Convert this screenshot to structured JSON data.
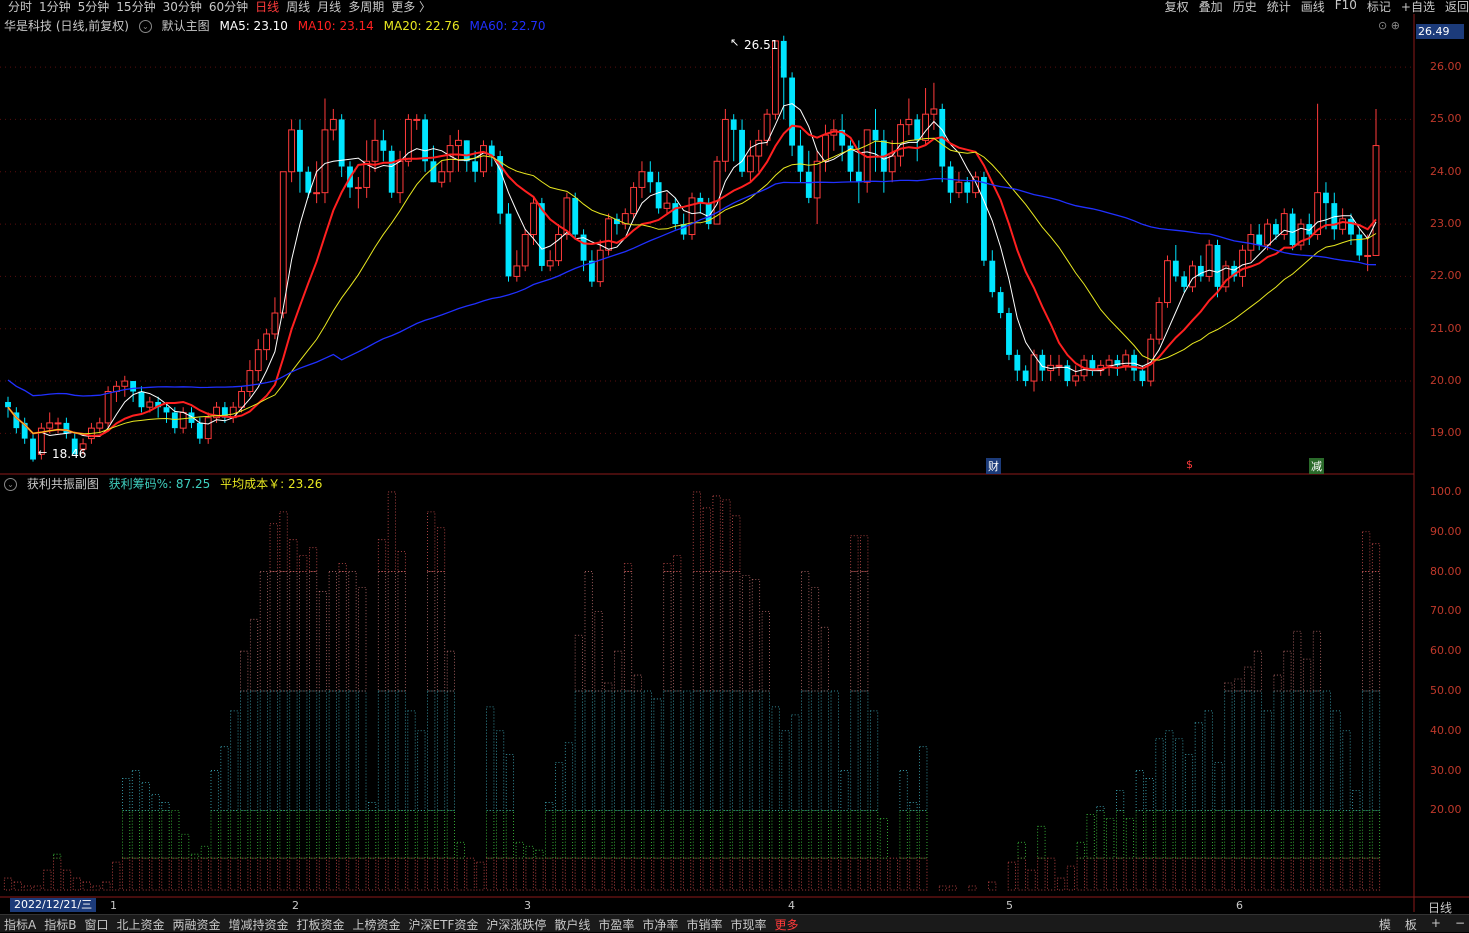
{
  "periods": [
    "分时",
    "1分钟",
    "5分钟",
    "15分钟",
    "30分钟",
    "60分钟",
    "日线",
    "周线",
    "月线",
    "多周期",
    "更多 〉"
  ],
  "active_period": "日线",
  "tools": [
    "复权",
    "叠加",
    "历史",
    "统计",
    "画线",
    "F10",
    "标记",
    "+自选",
    "返回"
  ],
  "main_header": {
    "title": "华是科技 (日线,前复权)",
    "indicator": "默认主图",
    "ma5": "MA5: 23.10",
    "ma10": "MA10: 23.14",
    "ma20": "MA20: 22.76",
    "ma60": "MA60: 22.70"
  },
  "sub_header": {
    "title": "获利共振副图",
    "chip": "获利筹码%: 87.25",
    "cost": "平均成本￥: 23.26"
  },
  "price_box": "26.49",
  "high_label": "26.51",
  "low_label": "18.46",
  "price_ticks": [
    "26.00",
    "25.00",
    "24.00",
    "23.00",
    "22.00",
    "21.00",
    "20.00",
    "19.00"
  ],
  "pct_ticks": [
    "100.0",
    "90.00",
    "80.00",
    "70.00",
    "60.00",
    "50.00",
    "40.00",
    "30.00",
    "20.00"
  ],
  "date_box": "2022/12/21/三",
  "month_labels": [
    "1",
    "2",
    "3",
    "4",
    "5",
    "6"
  ],
  "events": [
    "财",
    "$",
    "减"
  ],
  "period_label": "日线",
  "bottom_tabs": [
    "指标A",
    "指标B",
    "窗口",
    "北上资金",
    "两融资金",
    "增减持资金",
    "打板资金",
    "上榜资金",
    "沪深ETF资金",
    "沪深涨跌停",
    "散户线",
    "市盈率",
    "市净率",
    "市销率",
    "市现率",
    "更多"
  ],
  "bottom_right": [
    "模",
    "板",
    "+",
    "−"
  ],
  "colors": {
    "up": "#ff3b3b",
    "down": "#00e5ff",
    "ma5": "#ffffff",
    "ma10": "#ff2020",
    "ma20": "#e8e820",
    "ma60": "#2030ff"
  },
  "chart_data": {
    "type": "candlestick",
    "price_range": [
      18.3,
      26.9
    ],
    "candles": [
      [
        19.6,
        19.5,
        19.7,
        19.3
      ],
      [
        19.4,
        19.1,
        19.5,
        19.0
      ],
      [
        19.2,
        18.9,
        19.3,
        18.8
      ],
      [
        18.9,
        18.5,
        19.0,
        18.46
      ],
      [
        18.6,
        19.1,
        19.2,
        18.5
      ],
      [
        19.1,
        19.2,
        19.4,
        19.0
      ],
      [
        19.2,
        19.2,
        19.3,
        19.0
      ],
      [
        19.2,
        19.0,
        19.3,
        18.9
      ],
      [
        18.9,
        18.6,
        19.0,
        18.6
      ],
      [
        18.7,
        18.8,
        18.9,
        18.6
      ],
      [
        18.9,
        19.1,
        19.2,
        18.8
      ],
      [
        19.1,
        19.2,
        19.3,
        19.0
      ],
      [
        19.2,
        19.8,
        19.9,
        19.1
      ],
      [
        19.8,
        19.9,
        20.0,
        19.6
      ],
      [
        19.9,
        20.0,
        20.1,
        19.7
      ],
      [
        20.0,
        19.8,
        20.0,
        19.6
      ],
      [
        19.8,
        19.5,
        19.9,
        19.4
      ],
      [
        19.5,
        19.6,
        19.7,
        19.4
      ],
      [
        19.6,
        19.5,
        19.7,
        19.3
      ],
      [
        19.5,
        19.4,
        19.6,
        19.2
      ],
      [
        19.4,
        19.1,
        19.5,
        19.0
      ],
      [
        19.1,
        19.4,
        19.5,
        19.0
      ],
      [
        19.4,
        19.2,
        19.5,
        19.1
      ],
      [
        19.2,
        18.9,
        19.3,
        18.8
      ],
      [
        18.9,
        19.3,
        19.4,
        18.8
      ],
      [
        19.3,
        19.5,
        19.6,
        19.2
      ],
      [
        19.5,
        19.3,
        19.6,
        19.2
      ],
      [
        19.3,
        19.5,
        19.6,
        19.2
      ],
      [
        19.5,
        19.8,
        19.9,
        19.4
      ],
      [
        19.8,
        20.2,
        20.4,
        19.7
      ],
      [
        20.2,
        20.6,
        20.8,
        20.0
      ],
      [
        20.6,
        20.9,
        21.0,
        20.4
      ],
      [
        20.9,
        21.3,
        21.6,
        20.8
      ],
      [
        21.3,
        24.0,
        24.0,
        21.2
      ],
      [
        24.0,
        24.8,
        25.0,
        23.8
      ],
      [
        24.8,
        24.0,
        25.0,
        23.6
      ],
      [
        24.0,
        23.6,
        24.1,
        23.5
      ],
      [
        23.6,
        23.6,
        24.2,
        23.4
      ],
      [
        23.6,
        24.8,
        25.4,
        23.4
      ],
      [
        24.8,
        25.0,
        25.2,
        24.6
      ],
      [
        25.0,
        24.1,
        25.1,
        23.9
      ],
      [
        24.1,
        23.7,
        24.2,
        23.5
      ],
      [
        23.7,
        23.7,
        23.9,
        23.3
      ],
      [
        23.7,
        24.2,
        24.6,
        23.5
      ],
      [
        24.2,
        24.6,
        25.0,
        24.0
      ],
      [
        24.6,
        24.4,
        24.8,
        24.2
      ],
      [
        24.4,
        23.6,
        24.5,
        23.5
      ],
      [
        23.6,
        24.2,
        24.4,
        23.4
      ],
      [
        24.2,
        25.0,
        25.1,
        24.1
      ],
      [
        25.0,
        25.0,
        25.1,
        24.8
      ],
      [
        25.0,
        24.2,
        25.1,
        24.0
      ],
      [
        24.2,
        23.8,
        24.5,
        23.8
      ],
      [
        23.8,
        24.0,
        24.2,
        23.7
      ],
      [
        24.0,
        24.5,
        24.7,
        23.8
      ],
      [
        24.5,
        24.6,
        24.8,
        24.0
      ],
      [
        24.6,
        24.2,
        24.6,
        24.0
      ],
      [
        24.2,
        24.0,
        24.4,
        23.8
      ],
      [
        24.0,
        24.5,
        24.6,
        23.9
      ],
      [
        24.5,
        24.3,
        24.6,
        24.1
      ],
      [
        24.3,
        23.2,
        24.4,
        23.0
      ],
      [
        23.2,
        22.0,
        23.4,
        21.9
      ],
      [
        22.0,
        22.2,
        22.5,
        21.9
      ],
      [
        22.2,
        22.8,
        22.9,
        22.1
      ],
      [
        22.8,
        23.4,
        23.5,
        22.6
      ],
      [
        23.4,
        22.2,
        23.5,
        22.1
      ],
      [
        22.2,
        22.3,
        22.5,
        22.1
      ],
      [
        22.3,
        22.8,
        23.0,
        22.2
      ],
      [
        22.8,
        23.5,
        23.6,
        22.7
      ],
      [
        23.5,
        22.8,
        23.6,
        22.7
      ],
      [
        22.8,
        22.3,
        22.9,
        22.1
      ],
      [
        22.3,
        21.9,
        22.5,
        21.8
      ],
      [
        21.9,
        22.5,
        22.7,
        21.8
      ],
      [
        22.5,
        23.1,
        23.2,
        22.4
      ],
      [
        23.1,
        23.0,
        23.2,
        22.8
      ],
      [
        23.0,
        23.2,
        23.3,
        22.9
      ],
      [
        23.2,
        23.7,
        23.8,
        23.1
      ],
      [
        23.7,
        24.0,
        24.2,
        23.5
      ],
      [
        24.0,
        23.8,
        24.2,
        23.6
      ],
      [
        23.8,
        23.3,
        24.0,
        23.2
      ],
      [
        23.3,
        23.4,
        23.6,
        23.2
      ],
      [
        23.4,
        23.0,
        23.5,
        22.9
      ],
      [
        23.0,
        22.8,
        23.2,
        22.7
      ],
      [
        22.8,
        23.5,
        23.6,
        22.7
      ],
      [
        23.5,
        23.4,
        23.6,
        23.2
      ],
      [
        23.4,
        23.0,
        23.5,
        22.9
      ],
      [
        23.0,
        24.2,
        24.3,
        23.0
      ],
      [
        24.2,
        25.0,
        25.2,
        24.0
      ],
      [
        25.0,
        24.8,
        25.1,
        24.2
      ],
      [
        24.8,
        24.0,
        25.0,
        23.9
      ],
      [
        24.0,
        24.3,
        24.6,
        23.8
      ],
      [
        24.3,
        24.6,
        24.8,
        24.0
      ],
      [
        24.6,
        25.1,
        25.2,
        24.5
      ],
      [
        25.1,
        26.5,
        26.51,
        25.0
      ],
      [
        26.5,
        25.8,
        26.6,
        25.0
      ],
      [
        25.8,
        24.5,
        25.9,
        24.3
      ],
      [
        24.5,
        24.0,
        24.8,
        23.8
      ],
      [
        24.0,
        23.5,
        24.4,
        23.4
      ],
      [
        23.5,
        24.2,
        24.4,
        23.0
      ],
      [
        24.2,
        24.7,
        24.9,
        24.0
      ],
      [
        24.7,
        24.8,
        25.0,
        24.4
      ],
      [
        24.8,
        24.5,
        25.1,
        24.2
      ],
      [
        24.5,
        24.0,
        24.6,
        23.8
      ],
      [
        24.0,
        23.8,
        24.6,
        23.4
      ],
      [
        23.8,
        24.8,
        24.8,
        23.6
      ],
      [
        24.8,
        24.6,
        25.2,
        24.0
      ],
      [
        24.6,
        24.0,
        24.8,
        23.6
      ],
      [
        24.0,
        24.3,
        24.6,
        23.8
      ],
      [
        24.3,
        24.9,
        25.0,
        24.1
      ],
      [
        24.9,
        25.0,
        25.4,
        24.7
      ],
      [
        25.0,
        24.6,
        25.1,
        24.2
      ],
      [
        24.6,
        25.1,
        25.6,
        24.5
      ],
      [
        25.1,
        25.2,
        25.7,
        24.8
      ],
      [
        25.2,
        24.1,
        25.3,
        23.8
      ],
      [
        24.1,
        23.6,
        24.2,
        23.4
      ],
      [
        23.6,
        23.8,
        24.0,
        23.5
      ],
      [
        23.8,
        23.6,
        23.9,
        23.4
      ],
      [
        23.6,
        23.9,
        24.0,
        23.5
      ],
      [
        23.9,
        22.3,
        24.0,
        22.2
      ],
      [
        22.3,
        21.7,
        22.5,
        21.6
      ],
      [
        21.7,
        21.3,
        21.8,
        21.2
      ],
      [
        21.3,
        20.5,
        21.4,
        20.4
      ],
      [
        20.5,
        20.2,
        20.6,
        20.0
      ],
      [
        20.2,
        20.0,
        20.3,
        19.9
      ],
      [
        20.0,
        20.5,
        20.6,
        19.8
      ],
      [
        20.5,
        20.2,
        20.6,
        20.0
      ],
      [
        20.2,
        20.3,
        20.5,
        20.0
      ],
      [
        20.3,
        20.3,
        20.5,
        20.1
      ],
      [
        20.3,
        20.0,
        20.4,
        19.9
      ],
      [
        20.0,
        20.1,
        20.3,
        19.9
      ],
      [
        20.1,
        20.4,
        20.5,
        20.0
      ],
      [
        20.4,
        20.2,
        20.5,
        20.1
      ],
      [
        20.2,
        20.3,
        20.4,
        20.1
      ],
      [
        20.3,
        20.4,
        20.5,
        20.1
      ],
      [
        20.4,
        20.3,
        20.5,
        20.1
      ],
      [
        20.3,
        20.5,
        20.6,
        20.2
      ],
      [
        20.5,
        20.2,
        20.6,
        20.0
      ],
      [
        20.2,
        20.0,
        20.3,
        19.9
      ],
      [
        20.0,
        20.8,
        20.9,
        19.9
      ],
      [
        20.8,
        21.5,
        21.6,
        20.7
      ],
      [
        21.5,
        22.3,
        22.4,
        21.4
      ],
      [
        22.3,
        22.0,
        22.6,
        21.9
      ],
      [
        22.0,
        21.8,
        22.1,
        21.7
      ],
      [
        21.8,
        22.2,
        22.3,
        21.7
      ],
      [
        22.2,
        22.0,
        22.4,
        21.9
      ],
      [
        22.0,
        22.6,
        22.7,
        21.9
      ],
      [
        22.6,
        21.8,
        22.7,
        21.6
      ],
      [
        21.8,
        22.2,
        22.3,
        21.7
      ],
      [
        22.2,
        22.0,
        22.3,
        21.9
      ],
      [
        22.0,
        22.5,
        22.6,
        21.8
      ],
      [
        22.5,
        22.8,
        23.0,
        22.3
      ],
      [
        22.8,
        22.6,
        23.0,
        22.5
      ],
      [
        22.6,
        23.0,
        23.1,
        22.5
      ],
      [
        23.0,
        22.8,
        23.1,
        22.7
      ],
      [
        22.8,
        23.2,
        23.3,
        22.7
      ],
      [
        23.2,
        22.6,
        23.3,
        22.5
      ],
      [
        22.6,
        23.0,
        23.1,
        22.5
      ],
      [
        23.0,
        22.8,
        23.2,
        22.6
      ],
      [
        22.8,
        23.6,
        25.3,
        22.7
      ],
      [
        23.6,
        23.4,
        23.8,
        22.9
      ],
      [
        23.4,
        22.9,
        23.6,
        22.7
      ],
      [
        22.9,
        23.1,
        23.3,
        22.8
      ],
      [
        23.1,
        22.8,
        23.2,
        22.6
      ],
      [
        22.8,
        22.4,
        22.9,
        22.3
      ],
      [
        22.4,
        22.4,
        22.8,
        22.1
      ],
      [
        22.4,
        24.5,
        25.2,
        22.7
      ]
    ],
    "ma5_last": 23.1,
    "ma10_last": 23.14,
    "ma20_last": 22.76,
    "ma60_last": 22.7,
    "sub_values": [
      3,
      2,
      1,
      1,
      5,
      9,
      5,
      3,
      2,
      1,
      2,
      7,
      28,
      30,
      27,
      24,
      22,
      20,
      14,
      9,
      11,
      30,
      36,
      45,
      60,
      68,
      80,
      92,
      95,
      88,
      84,
      86,
      75,
      80,
      82,
      80,
      76,
      22,
      88,
      100,
      85,
      45,
      40,
      95,
      91,
      60,
      12,
      8,
      7,
      46,
      40,
      34,
      12,
      11,
      10,
      22,
      32,
      37,
      64,
      80,
      70,
      52,
      60,
      82,
      54,
      50,
      48,
      82,
      84,
      50,
      100,
      96,
      99,
      98,
      94,
      79,
      78,
      70,
      46,
      40,
      44,
      80,
      76,
      66,
      50,
      30,
      89,
      89,
      45,
      18,
      8,
      30,
      22,
      36,
      0,
      1,
      1,
      0,
      1,
      0,
      2,
      0,
      7,
      12,
      5,
      16,
      8,
      3,
      6,
      12,
      19,
      21,
      18,
      25,
      18,
      30,
      28,
      38,
      40,
      38,
      34,
      42,
      45,
      32,
      52,
      53,
      56,
      60,
      45,
      54,
      60,
      65,
      58,
      65,
      50,
      45,
      40,
      25,
      90,
      87
    ]
  }
}
